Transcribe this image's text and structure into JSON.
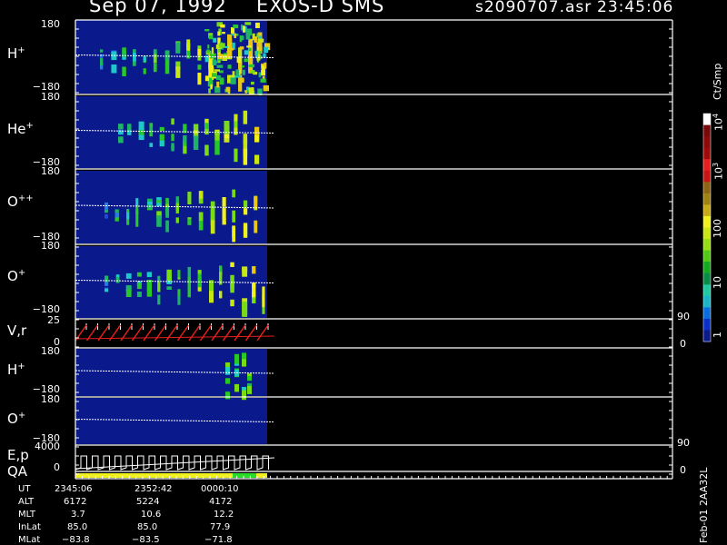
{
  "header": {
    "date": "Sep 07, 1992",
    "mission": "EXOS-D SMS",
    "file": "s2090707.asr",
    "time": "23:45:06"
  },
  "panels": [
    {
      "ion": "H",
      "charge": "+",
      "ymax": "180",
      "ymin": "−180"
    },
    {
      "ion": "He",
      "charge": "+",
      "ymax": "180",
      "ymin": "−180"
    },
    {
      "ion": "O",
      "charge": "++",
      "ymax": "180",
      "ymin": "−180"
    },
    {
      "ion": "O",
      "charge": "+",
      "ymax": "180",
      "ymin": "−180"
    },
    {
      "ion": "V,r",
      "charge": "",
      "ymax": "25",
      "ymin": "0",
      "right_max": "90",
      "right_min": "0"
    },
    {
      "ion": "H",
      "charge": "+",
      "ymax": "180",
      "ymin": "−180"
    },
    {
      "ion": "O",
      "charge": "+",
      "ymax": "180",
      "ymin": "−180"
    },
    {
      "ion": "E,p",
      "charge": "",
      "ymax": "4000",
      "ymin": "0",
      "right_max": "90",
      "right_min": "0"
    },
    {
      "ion": "QA",
      "charge": ""
    }
  ],
  "colorbar": {
    "unit": "Ct/Smp",
    "labels": [
      "1",
      "10",
      "100",
      "10",
      "10"
    ],
    "label_exps": [
      "",
      "",
      "",
      "3",
      "4"
    ],
    "colors": [
      "#0a1a8c",
      "#0a30c8",
      "#0a6ee0",
      "#19b4c8",
      "#1ec8a0",
      "#0a8c46",
      "#14aa1e",
      "#50c814",
      "#96dc14",
      "#c8e614",
      "#f0f01e",
      "#c8aa14",
      "#a08214",
      "#8c6414",
      "#c81414",
      "#e61e1e",
      "#a00a0a",
      "#8c0a0a",
      "#780a0a",
      "#ffffff"
    ]
  },
  "info_table": {
    "rows": [
      {
        "label": "UT",
        "values": [
          "2345:06",
          "2352:42",
          "0000:10"
        ]
      },
      {
        "label": "ALT",
        "values": [
          "6172",
          "5224",
          "4172"
        ]
      },
      {
        "label": "MLT",
        "values": [
          "3.7",
          "10.6",
          "12.2"
        ]
      },
      {
        "label": "InLat",
        "values": [
          "85.0",
          "85.0",
          "77.9"
        ]
      },
      {
        "label": "MLat",
        "values": [
          "−83.8",
          "−83.5",
          "−71.8"
        ]
      }
    ]
  },
  "footer_id": "Feb-01 2AA32L"
}
